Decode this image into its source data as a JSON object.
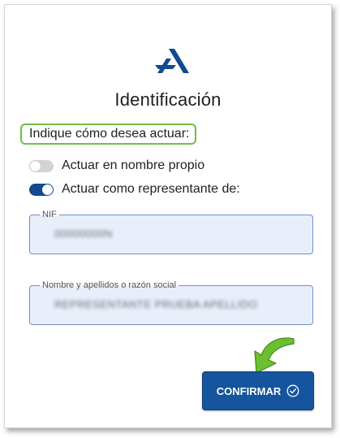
{
  "dialog": {
    "title": "Identificación",
    "prompt": "Indique cómo desea actuar:",
    "options": [
      {
        "label": "Actuar en nombre propio",
        "selected": false
      },
      {
        "label": "Actuar como representante de:",
        "selected": true
      }
    ],
    "nif_field": {
      "label": "NIF",
      "value": "00000000N"
    },
    "name_field": {
      "label": "Nombre y apellidos o razón social",
      "value": "REPRESENTANTE PRUEBA APELLIDO"
    },
    "confirm_button": {
      "label": "CONFIRMAR",
      "icon": "check-circle-icon"
    },
    "colors": {
      "accent": "#15559e",
      "highlight": "#72bf44",
      "toggle_on": "#114a8f",
      "field_bg": "#e8effb"
    },
    "logo_icon": "agency-logo-icon",
    "annotation_icon": "green-arrow-icon"
  }
}
